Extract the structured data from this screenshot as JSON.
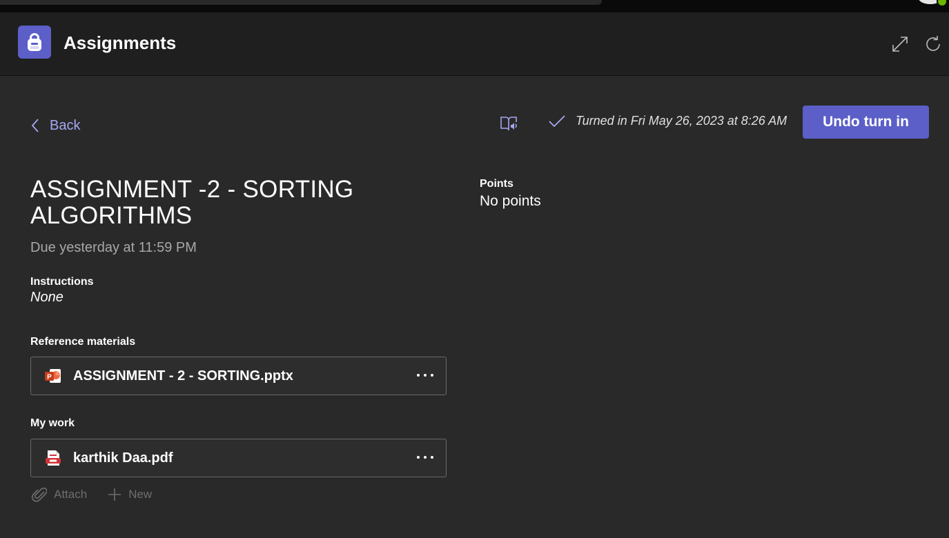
{
  "app": {
    "title": "Assignments",
    "brand_color": "#5b5fc7"
  },
  "toolbar": {
    "expand_icon": "expand-icon",
    "refresh_icon": "refresh-icon"
  },
  "nav": {
    "back_label": "Back"
  },
  "status": {
    "turned_in_text": "Turned in Fri May 26, 2023 at 8:26 AM",
    "undo_label": "Undo turn in",
    "reader_icon": "immersive-reader-icon"
  },
  "assignment": {
    "title": "ASSIGNMENT -2 - SORTING ALGORITHMS",
    "due": "Due yesterday at 11:59 PM",
    "instructions_label": "Instructions",
    "instructions_value": "None",
    "reference_label": "Reference materials",
    "reference_files": [
      {
        "name": "ASSIGNMENT - 2 - SORTING.pptx",
        "icon": "powerpoint-icon"
      }
    ],
    "my_work_label": "My work",
    "my_work_files": [
      {
        "name": "karthik Daa.pdf",
        "icon": "pdf-icon"
      }
    ],
    "attach_label": "Attach",
    "new_label": "New"
  },
  "points": {
    "label": "Points",
    "value": "No points"
  }
}
